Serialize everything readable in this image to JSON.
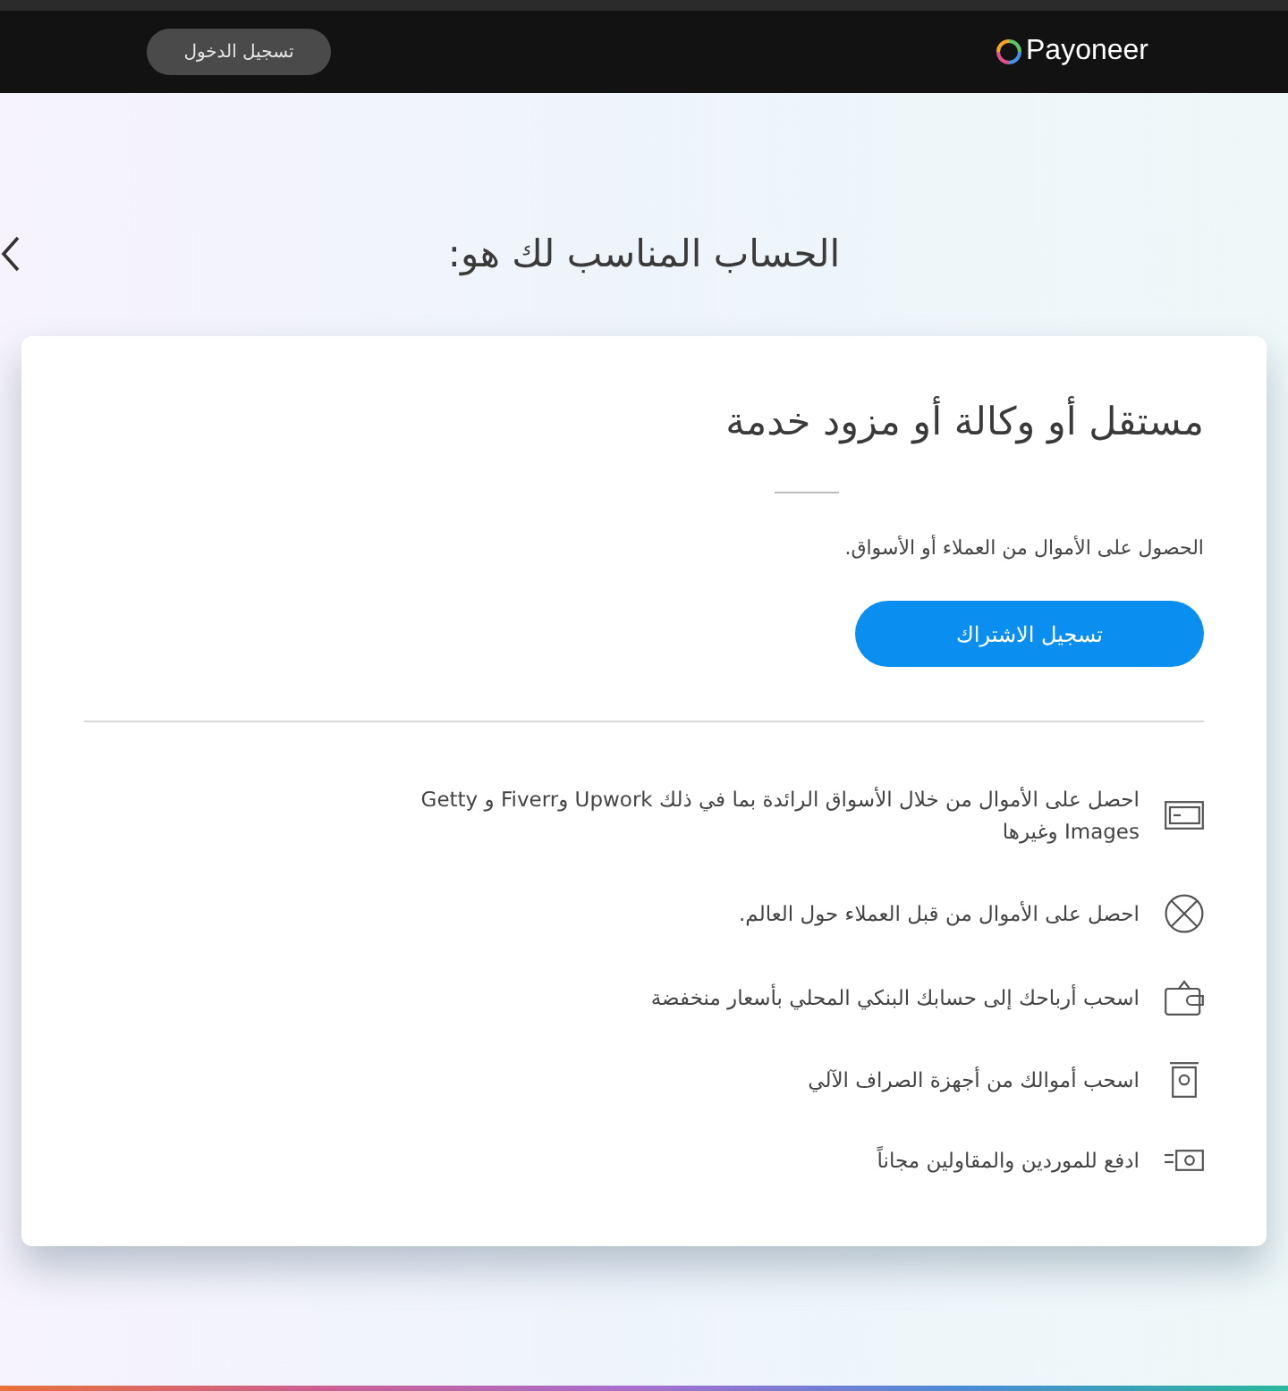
{
  "header": {
    "logo_text": "Payoneer",
    "login_button": "تسجيل الدخول"
  },
  "page_title": "الحساب المناسب لك هو:",
  "card": {
    "title": "مستقل أو وكالة أو مزود خدمة",
    "subtitle": "الحصول على الأموال من العملاء أو الأسواق.",
    "signup_button": "تسجيل الاشتراك",
    "features": [
      {
        "kind": "card",
        "text": "احصل على الأموال من خلال الأسواق الرائدة بما في ذلك Upwork وFiverr و Getty Images وغيرها"
      },
      {
        "kind": "globe",
        "text": "احصل على الأموال من قبل العملاء حول العالم."
      },
      {
        "kind": "wallet",
        "text": "اسحب أرباحك إلى حسابك البنكي المحلي بأسعار منخفضة"
      },
      {
        "kind": "atm",
        "text": "اسحب أموالك من أجهزة الصراف الآلي"
      },
      {
        "kind": "cash",
        "text": "ادفع للموردين والمقاولين مجاناً"
      }
    ]
  }
}
